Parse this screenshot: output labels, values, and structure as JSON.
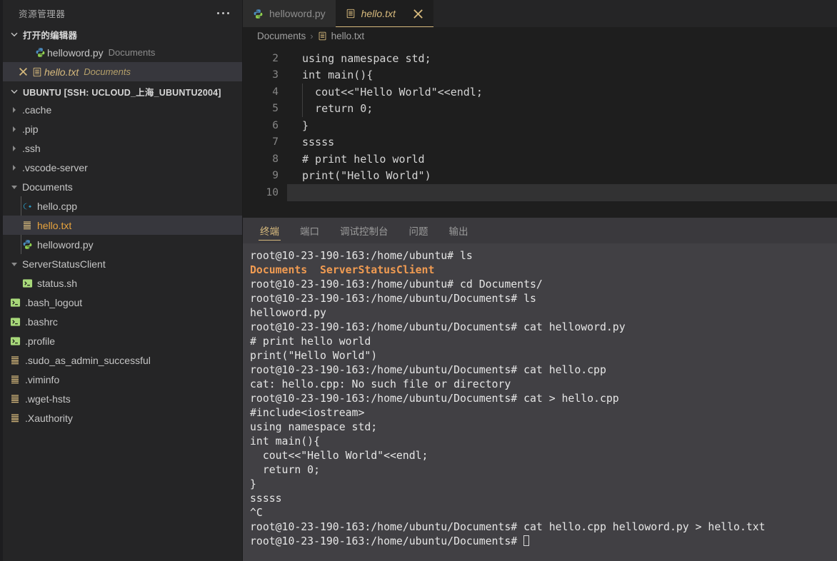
{
  "window": {
    "accent_yellow": "#d7ba7d",
    "sidebar_bg": "#252526",
    "editor_bg": "#1e1e1e",
    "terminal_bg": "#414044",
    "selection_bg": "#37373d",
    "terminal_dir_color": "#f09b52"
  },
  "sidebar": {
    "title": "资源管理器",
    "more_actions_icon": "ellipsis-icon",
    "open_editors": {
      "label": "打开的编辑器",
      "chevron": "chevron-down-icon",
      "items": [
        {
          "name": "helloword.py",
          "dir": "Documents",
          "icon": "python-file-icon",
          "active": false,
          "dirty": false
        },
        {
          "name": "hello.txt",
          "dir": "Documents",
          "icon": "text-file-icon",
          "active": true,
          "dirty": true,
          "close_icon": "close-icon"
        }
      ]
    },
    "workspace": {
      "label": "UBUNTU [SSH: UCLOUD_上海_UBUNTU2004]",
      "chevron": "chevron-down-icon",
      "tree": [
        {
          "name": ".cache",
          "type": "folder",
          "state": "collapsed",
          "depth": 1,
          "icon": "chevron-right-icon"
        },
        {
          "name": ".pip",
          "type": "folder",
          "state": "collapsed",
          "depth": 1,
          "icon": "chevron-right-icon"
        },
        {
          "name": ".ssh",
          "type": "folder",
          "state": "collapsed",
          "depth": 1,
          "icon": "chevron-right-icon"
        },
        {
          "name": ".vscode-server",
          "type": "folder",
          "state": "collapsed",
          "depth": 1,
          "icon": "chevron-right-icon"
        },
        {
          "name": "Documents",
          "type": "folder",
          "state": "expanded",
          "depth": 1,
          "icon": "chevron-down-icon"
        },
        {
          "name": "hello.cpp",
          "type": "file",
          "depth": 2,
          "icon": "cpp-file-icon",
          "selected": false
        },
        {
          "name": "hello.txt",
          "type": "file",
          "depth": 2,
          "icon": "text-file-icon",
          "selected": true
        },
        {
          "name": "helloword.py",
          "type": "file",
          "depth": 2,
          "icon": "python-file-icon",
          "selected": false
        },
        {
          "name": "ServerStatusClient",
          "type": "folder",
          "state": "expanded",
          "depth": 1,
          "icon": "chevron-down-icon"
        },
        {
          "name": "status.sh",
          "type": "file",
          "depth": 2,
          "icon": "shell-file-icon"
        },
        {
          "name": ".bash_logout",
          "type": "file",
          "depth": 1,
          "icon": "shell-file-icon"
        },
        {
          "name": ".bashrc",
          "type": "file",
          "depth": 1,
          "icon": "shell-file-icon"
        },
        {
          "name": ".profile",
          "type": "file",
          "depth": 1,
          "icon": "shell-file-icon"
        },
        {
          "name": ".sudo_as_admin_successful",
          "type": "file",
          "depth": 1,
          "icon": "text-file-icon"
        },
        {
          "name": ".viminfo",
          "type": "file",
          "depth": 1,
          "icon": "text-file-icon"
        },
        {
          "name": ".wget-hsts",
          "type": "file",
          "depth": 1,
          "icon": "text-file-icon"
        },
        {
          "name": ".Xauthority",
          "type": "file",
          "depth": 1,
          "icon": "text-file-icon"
        }
      ]
    }
  },
  "editor": {
    "tabs": [
      {
        "label": "helloword.py",
        "icon": "python-file-icon",
        "active": false
      },
      {
        "label": "hello.txt",
        "icon": "text-file-icon",
        "active": true,
        "close_icon": "close-icon"
      }
    ],
    "breadcrumb": {
      "root": "Documents",
      "separator": "›",
      "file": "hello.txt",
      "file_icon": "text-file-icon"
    },
    "lines": [
      {
        "no": "2",
        "text": "using namespace std;",
        "indent_guide": false
      },
      {
        "no": "3",
        "text": "int main(){",
        "indent_guide": false
      },
      {
        "no": "4",
        "text": "  cout<<\"Hello World\"<<endl;",
        "indent_guide": true
      },
      {
        "no": "5",
        "text": "  return 0;",
        "indent_guide": true
      },
      {
        "no": "6",
        "text": "}",
        "indent_guide": false
      },
      {
        "no": "7",
        "text": "sssss",
        "indent_guide": false
      },
      {
        "no": "8",
        "text": "# print hello world",
        "indent_guide": false
      },
      {
        "no": "9",
        "text": "print(\"Hello World\")",
        "indent_guide": false
      },
      {
        "no": "10",
        "text": "",
        "indent_guide": false,
        "current": true
      }
    ]
  },
  "panel": {
    "tabs": [
      {
        "label": "终端",
        "active": true
      },
      {
        "label": "端口",
        "active": false
      },
      {
        "label": "调试控制台",
        "active": false
      },
      {
        "label": "问题",
        "active": false
      },
      {
        "label": "输出",
        "active": false
      }
    ],
    "terminal": {
      "prompt_home": "root@10-23-190-163:/home/ubuntu# ",
      "prompt_docs": "root@10-23-190-163:/home/ubuntu/Documents# ",
      "lines": [
        {
          "kind": "prompt",
          "cwd": "home",
          "cmd": "ls"
        },
        {
          "kind": "dirlist",
          "items": [
            "Documents",
            "ServerStatusClient"
          ]
        },
        {
          "kind": "prompt",
          "cwd": "home",
          "cmd": "cd Documents/"
        },
        {
          "kind": "prompt",
          "cwd": "documents",
          "cmd": "ls"
        },
        {
          "kind": "out",
          "text": "helloword.py"
        },
        {
          "kind": "prompt",
          "cwd": "documents",
          "cmd": "cat helloword.py"
        },
        {
          "kind": "out",
          "text": "# print hello world"
        },
        {
          "kind": "out",
          "text": "print(\"Hello World\")"
        },
        {
          "kind": "prompt",
          "cwd": "documents",
          "cmd": "cat hello.cpp"
        },
        {
          "kind": "out",
          "text": "cat: hello.cpp: No such file or directory"
        },
        {
          "kind": "prompt",
          "cwd": "documents",
          "cmd": "cat > hello.cpp"
        },
        {
          "kind": "out",
          "text": "#include<iostream>"
        },
        {
          "kind": "out",
          "text": "using namespace std;"
        },
        {
          "kind": "out",
          "text": "int main(){"
        },
        {
          "kind": "out",
          "text": "  cout<<\"Hello World\"<<endl;"
        },
        {
          "kind": "out",
          "text": "  return 0;"
        },
        {
          "kind": "out",
          "text": "}"
        },
        {
          "kind": "out",
          "text": "sssss"
        },
        {
          "kind": "out",
          "text": "^C"
        },
        {
          "kind": "prompt",
          "cwd": "documents",
          "cmd": "cat hello.cpp helloword.py > hello.txt"
        },
        {
          "kind": "prompt",
          "cwd": "documents",
          "cmd": "",
          "cursor": true
        }
      ]
    }
  }
}
